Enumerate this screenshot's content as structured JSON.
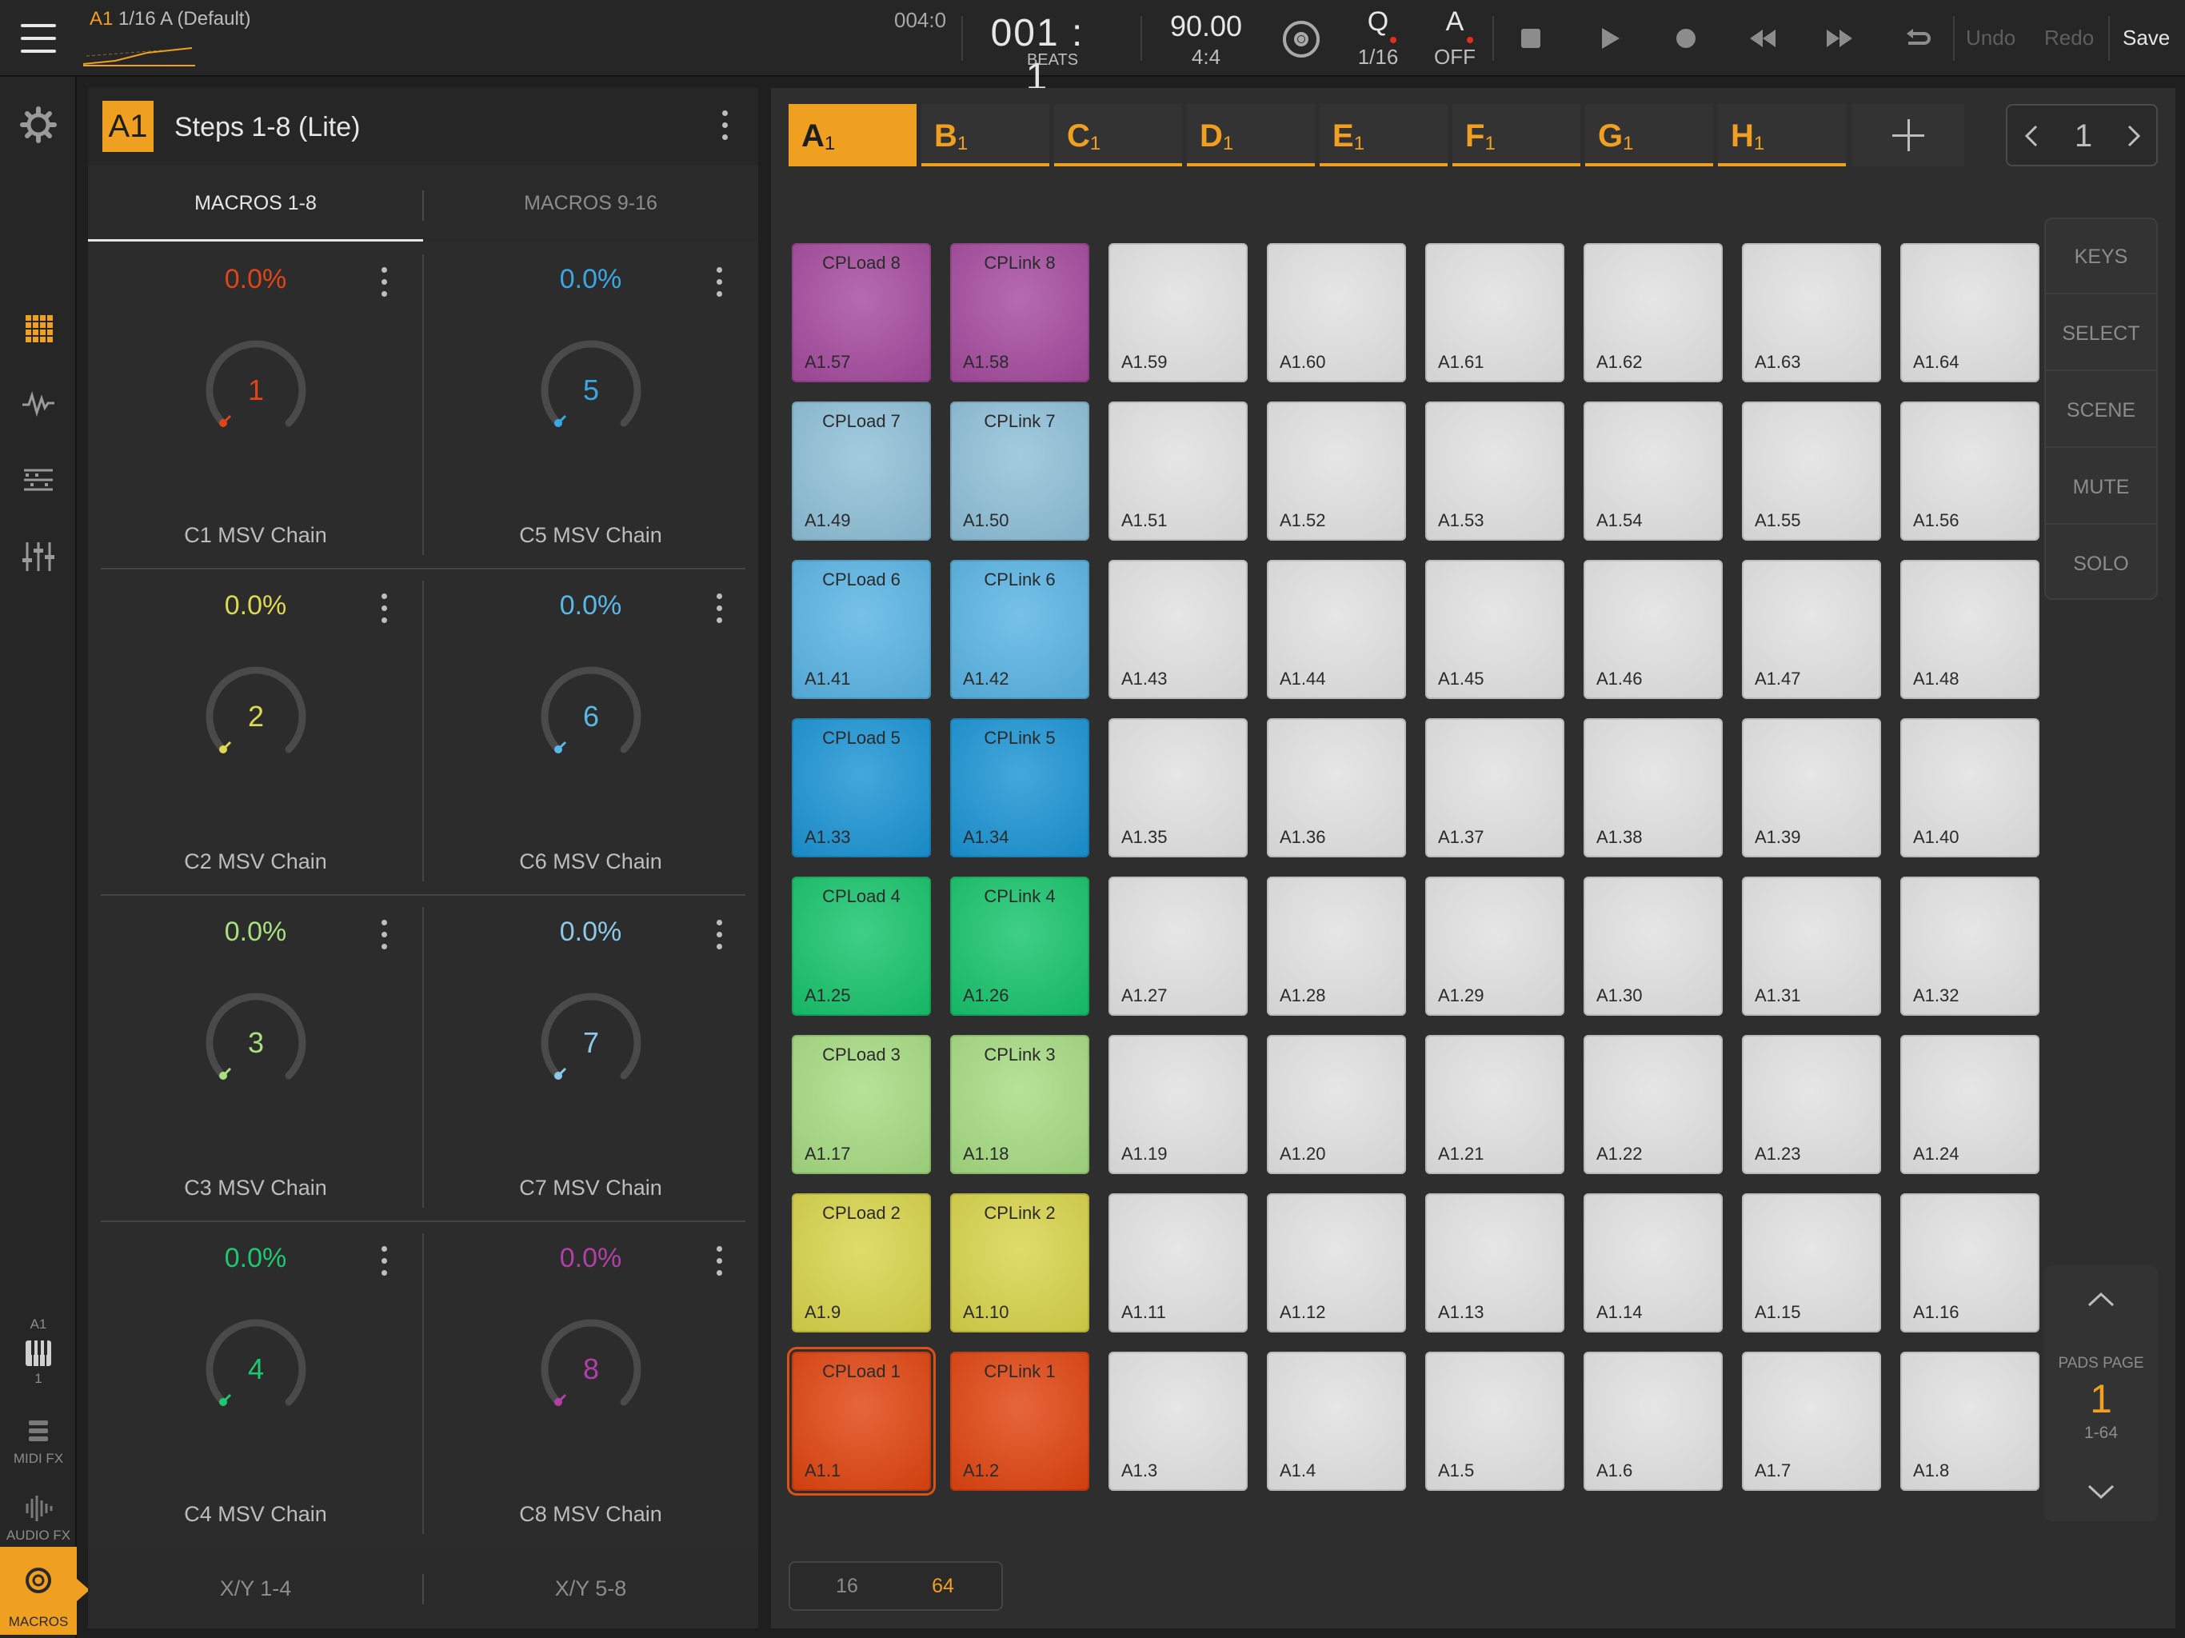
{
  "topbar": {
    "clip_slot": "A1",
    "clip_name": "1/16 A (Default)",
    "position_readout": "004:0",
    "bars_beats": "001 : 1",
    "beats_label": "BEATS",
    "tempo": "90.00",
    "time_signature": "4:4",
    "quantize_label": "Q",
    "quantize_value": "1/16",
    "automation_label": "A",
    "automation_value": "OFF",
    "undo": "Undo",
    "redo": "Redo",
    "save": "Save",
    "accent": "#f0a020"
  },
  "rail": {
    "track_slot": "A1",
    "track_num": "1",
    "midi_fx": "MIDI FX",
    "audio_fx": "AUDIO FX",
    "macros": "MACROS"
  },
  "macro_panel": {
    "badge": "A1",
    "title": "Steps 1-8 (Lite)",
    "tabs": [
      "MACROS 1-8",
      "MACROS 9-16"
    ],
    "macros": [
      {
        "value": "0.0%",
        "number": "1",
        "name": "C1 MSV Chain",
        "color": "#e0451a"
      },
      {
        "value": "0.0%",
        "number": "5",
        "name": "C5 MSV Chain",
        "color": "#3aa8e0"
      },
      {
        "value": "0.0%",
        "number": "2",
        "name": "C2 MSV Chain",
        "color": "#dcd850"
      },
      {
        "value": "0.0%",
        "number": "6",
        "name": "C6 MSV Chain",
        "color": "#5ab8e8"
      },
      {
        "value": "0.0%",
        "number": "3",
        "name": "C3 MSV Chain",
        "color": "#a8e080"
      },
      {
        "value": "0.0%",
        "number": "7",
        "name": "C7 MSV Chain",
        "color": "#8cc8e8"
      },
      {
        "value": "0.0%",
        "number": "4",
        "name": "C4 MSV Chain",
        "color": "#1ec870"
      },
      {
        "value": "0.0%",
        "number": "8",
        "name": "C8 MSV Chain",
        "color": "#b040a8"
      }
    ],
    "xy_tabs": [
      "X/Y 1-4",
      "X/Y 5-8"
    ]
  },
  "scenes": {
    "tabs": [
      {
        "letter": "A",
        "num": "1"
      },
      {
        "letter": "B",
        "num": "1"
      },
      {
        "letter": "C",
        "num": "1"
      },
      {
        "letter": "D",
        "num": "1"
      },
      {
        "letter": "E",
        "num": "1"
      },
      {
        "letter": "F",
        "num": "1"
      },
      {
        "letter": "G",
        "num": "1"
      },
      {
        "letter": "H",
        "num": "1"
      }
    ],
    "page": "1"
  },
  "pads": {
    "rows": [
      [
        {
          "name": "CPLoad 8",
          "id": "A1.57",
          "color": "#a54a9e"
        },
        {
          "name": "CPLink 8",
          "id": "A1.58",
          "color": "#a54a9e"
        },
        {
          "name": "",
          "id": "A1.59"
        },
        {
          "name": "",
          "id": "A1.60"
        },
        {
          "name": "",
          "id": "A1.61"
        },
        {
          "name": "",
          "id": "A1.62"
        },
        {
          "name": "",
          "id": "A1.63"
        },
        {
          "name": "",
          "id": "A1.64"
        }
      ],
      [
        {
          "name": "CPLoad 7",
          "id": "A1.49",
          "color": "#8ec0d8"
        },
        {
          "name": "CPLink 7",
          "id": "A1.50",
          "color": "#8ec0d8"
        },
        {
          "name": "",
          "id": "A1.51"
        },
        {
          "name": "",
          "id": "A1.52"
        },
        {
          "name": "",
          "id": "A1.53"
        },
        {
          "name": "",
          "id": "A1.54"
        },
        {
          "name": "",
          "id": "A1.55"
        },
        {
          "name": "",
          "id": "A1.56"
        }
      ],
      [
        {
          "name": "CPLoad 6",
          "id": "A1.41",
          "color": "#58b4e4"
        },
        {
          "name": "CPLink 6",
          "id": "A1.42",
          "color": "#58b4e4"
        },
        {
          "name": "",
          "id": "A1.43"
        },
        {
          "name": "",
          "id": "A1.44"
        },
        {
          "name": "",
          "id": "A1.45"
        },
        {
          "name": "",
          "id": "A1.46"
        },
        {
          "name": "",
          "id": "A1.47"
        },
        {
          "name": "",
          "id": "A1.48"
        }
      ],
      [
        {
          "name": "CPLoad 5",
          "id": "A1.33",
          "color": "#1a94d4"
        },
        {
          "name": "CPLink 5",
          "id": "A1.34",
          "color": "#1a94d4"
        },
        {
          "name": "",
          "id": "A1.35"
        },
        {
          "name": "",
          "id": "A1.36"
        },
        {
          "name": "",
          "id": "A1.37"
        },
        {
          "name": "",
          "id": "A1.38"
        },
        {
          "name": "",
          "id": "A1.39"
        },
        {
          "name": "",
          "id": "A1.40"
        }
      ],
      [
        {
          "name": "CPLoad 4",
          "id": "A1.25",
          "color": "#16c46c"
        },
        {
          "name": "CPLink 4",
          "id": "A1.26",
          "color": "#16c46c"
        },
        {
          "name": "",
          "id": "A1.27"
        },
        {
          "name": "",
          "id": "A1.28"
        },
        {
          "name": "",
          "id": "A1.29"
        },
        {
          "name": "",
          "id": "A1.30"
        },
        {
          "name": "",
          "id": "A1.31"
        },
        {
          "name": "",
          "id": "A1.32"
        }
      ],
      [
        {
          "name": "CPLoad 3",
          "id": "A1.17",
          "color": "#a6dc82"
        },
        {
          "name": "CPLink 3",
          "id": "A1.18",
          "color": "#a6dc82"
        },
        {
          "name": "",
          "id": "A1.19"
        },
        {
          "name": "",
          "id": "A1.20"
        },
        {
          "name": "",
          "id": "A1.21"
        },
        {
          "name": "",
          "id": "A1.22"
        },
        {
          "name": "",
          "id": "A1.23"
        },
        {
          "name": "",
          "id": "A1.24"
        }
      ],
      [
        {
          "name": "CPLoad 2",
          "id": "A1.9",
          "color": "#d8d44a"
        },
        {
          "name": "CPLink 2",
          "id": "A1.10",
          "color": "#d8d44a"
        },
        {
          "name": "",
          "id": "A1.11"
        },
        {
          "name": "",
          "id": "A1.12"
        },
        {
          "name": "",
          "id": "A1.13"
        },
        {
          "name": "",
          "id": "A1.14"
        },
        {
          "name": "",
          "id": "A1.15"
        },
        {
          "name": "",
          "id": "A1.16"
        }
      ],
      [
        {
          "name": "CPLoad 1",
          "id": "A1.1",
          "color": "#e0440f",
          "selected": true
        },
        {
          "name": "CPLink 1",
          "id": "A1.2",
          "color": "#e0440f"
        },
        {
          "name": "",
          "id": "A1.3"
        },
        {
          "name": "",
          "id": "A1.4"
        },
        {
          "name": "",
          "id": "A1.5"
        },
        {
          "name": "",
          "id": "A1.6"
        },
        {
          "name": "",
          "id": "A1.7"
        },
        {
          "name": "",
          "id": "A1.8"
        }
      ]
    ],
    "empty_color": "#dcdcdc"
  },
  "modes": [
    "KEYS",
    "SELECT",
    "SCENE",
    "MUTE",
    "SOLO"
  ],
  "pads_page": {
    "label": "PADS PAGE",
    "number": "1",
    "range": "1-64"
  },
  "grid_size": {
    "options": [
      "16",
      "64"
    ],
    "selected": "64"
  }
}
